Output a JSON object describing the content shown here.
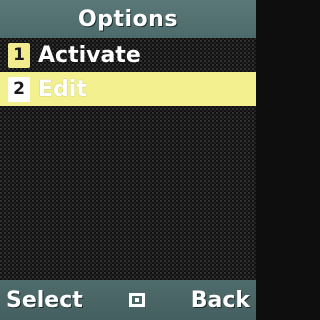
{
  "header": {
    "title": "Options"
  },
  "menu": {
    "items": [
      {
        "number": "1",
        "label": "Activate",
        "selected": false
      },
      {
        "number": "2",
        "label": "Edit",
        "selected": true
      }
    ]
  },
  "softkeys": {
    "left": "Select",
    "center_icon": "center-select-icon",
    "right": "Back"
  },
  "colors": {
    "title_bar": "#52706f",
    "highlight": "#f3f18f",
    "badge": "#f3ec8e",
    "background": "#101010"
  }
}
